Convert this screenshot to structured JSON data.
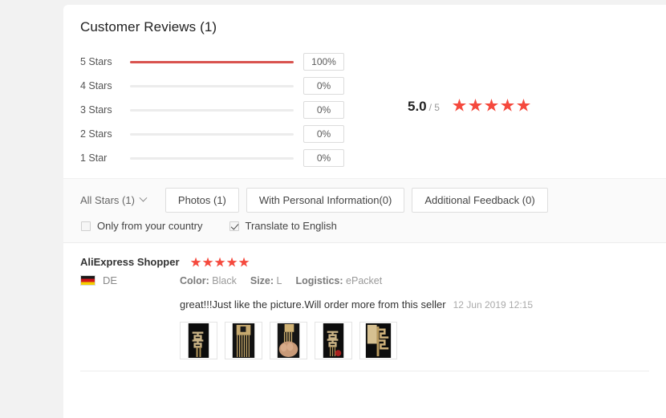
{
  "section": {
    "title": "Customer Reviews (1)"
  },
  "rating_summary": {
    "average": "5.0",
    "denominator": "/ 5",
    "stars_filled": 5,
    "bars": [
      {
        "label": "5 Stars",
        "percent_label": "100%",
        "percent": 100
      },
      {
        "label": "4 Stars",
        "percent_label": "0%",
        "percent": 0
      },
      {
        "label": "3 Stars",
        "percent_label": "0%",
        "percent": 0
      },
      {
        "label": "2 Stars",
        "percent_label": "0%",
        "percent": 0
      },
      {
        "label": "1 Star",
        "percent_label": "0%",
        "percent": 0
      }
    ]
  },
  "filters": {
    "all_stars_label": "All Stars (1)",
    "chevron_icon": "chevron-down-icon",
    "buttons": [
      {
        "label": "Photos (1)"
      },
      {
        "label": "With Personal Information(0)"
      },
      {
        "label": "Additional Feedback (0)"
      }
    ],
    "checkboxes": [
      {
        "label": "Only from your country",
        "checked": false
      },
      {
        "label": "Translate to English",
        "checked": true
      }
    ]
  },
  "review": {
    "author": "AliExpress Shopper",
    "stars": 5,
    "country_code": "DE",
    "country_flag_icon": "germany-flag-icon",
    "attributes": [
      {
        "key": "Color:",
        "value": "Black"
      },
      {
        "key": "Size:",
        "value": "L"
      },
      {
        "key": "Logistics:",
        "value": "ePacket"
      }
    ],
    "text": "great!!!Just like the picture.Will order more from this seller",
    "date": "12 Jun 2019 12:15",
    "photo_count": 5,
    "photos": [
      {
        "name": "review-photo-1"
      },
      {
        "name": "review-photo-2"
      },
      {
        "name": "review-photo-3"
      },
      {
        "name": "review-photo-4"
      },
      {
        "name": "review-photo-5"
      }
    ]
  },
  "colors": {
    "bar_fill": "#d9534f",
    "star": "#f5493d",
    "page_background": "#f2f2f2",
    "card_background": "#ffffff",
    "filter_band_background": "#fafafa"
  }
}
